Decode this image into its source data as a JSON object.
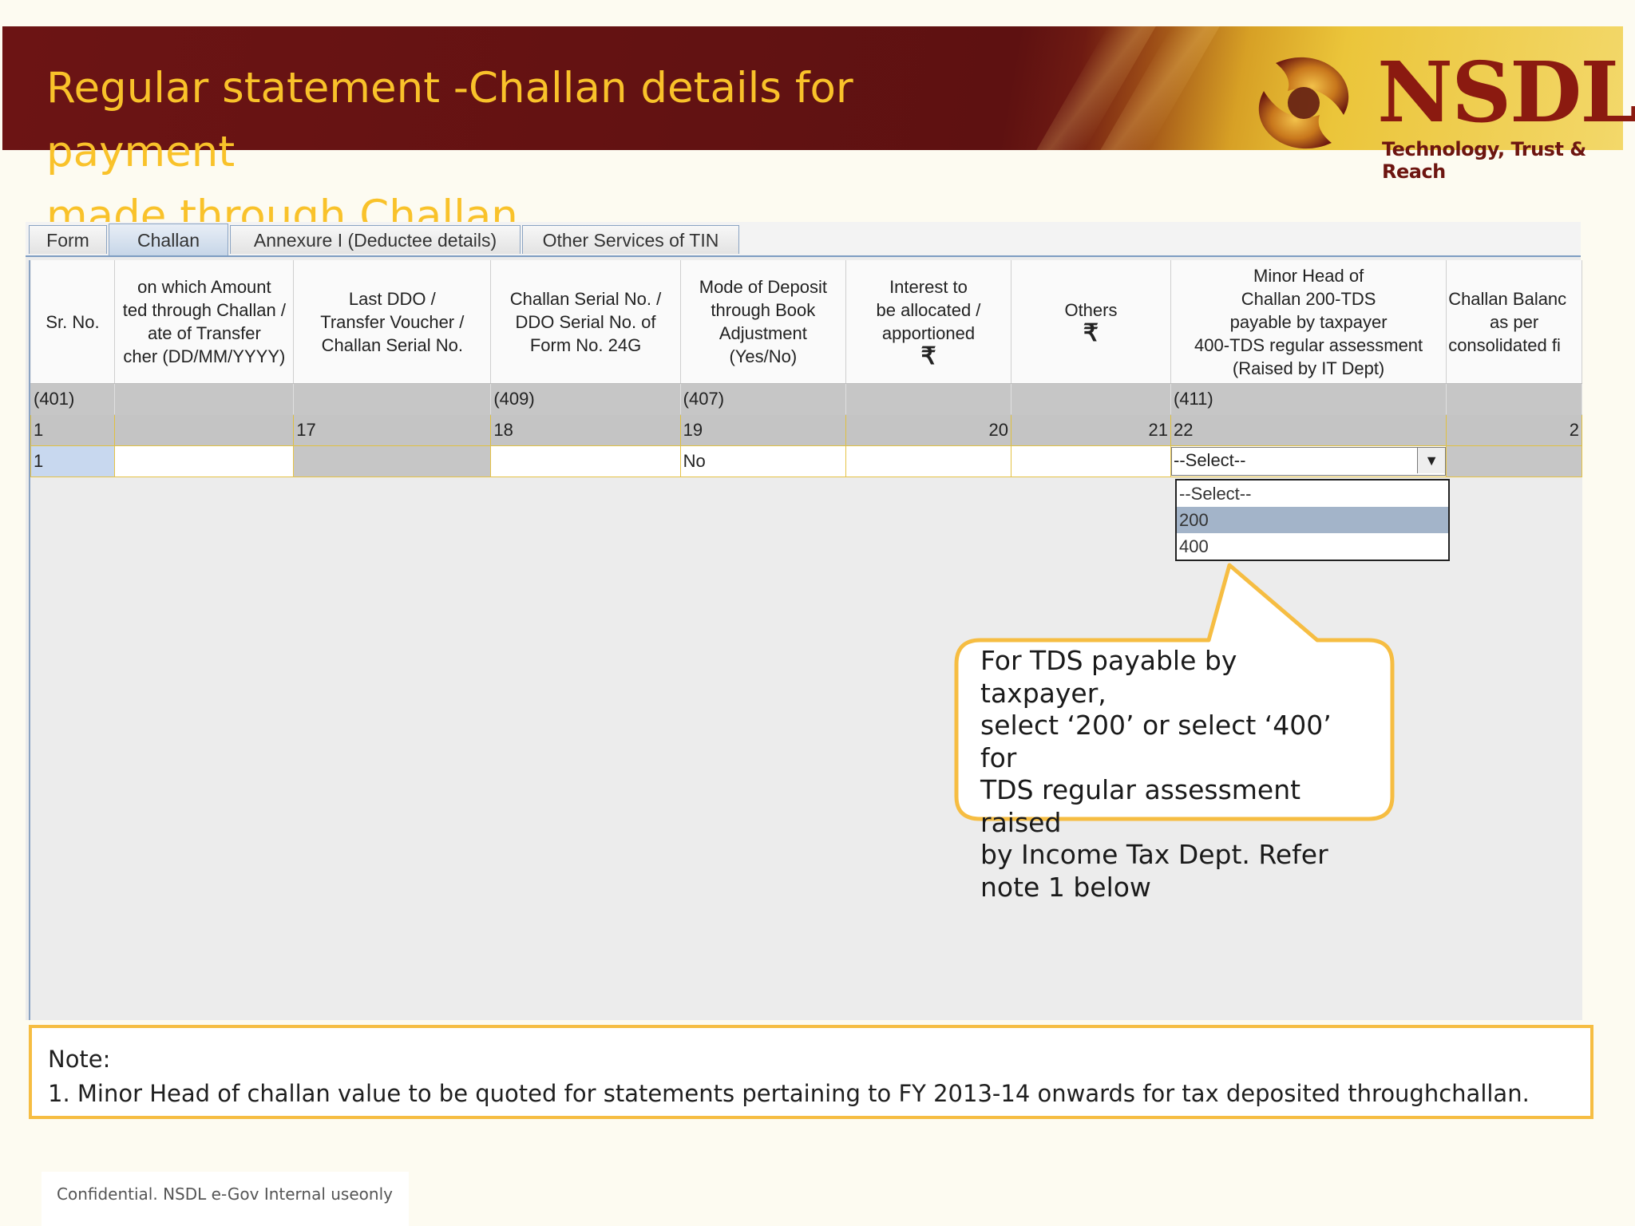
{
  "header": {
    "title_line1": "Regular statement -Challan details for payment",
    "title_line2": "made through Challan",
    "logo_name": "NSDL",
    "logo_tagline": "Technology, Trust & Reach",
    "colors": {
      "banner": "#5e1111",
      "title": "#f9c22a",
      "logo": "#8b1a10"
    }
  },
  "tabs": [
    {
      "label": "Form",
      "active": false
    },
    {
      "label": "Challan",
      "active": true
    },
    {
      "label": "Annexure I (Deductee details)",
      "active": false
    },
    {
      "label": "Other Services of TIN",
      "active": false
    }
  ],
  "table": {
    "headers": [
      {
        "lines": [
          "Sr. No."
        ]
      },
      {
        "lines": [
          "on which Amount",
          "ted through Challan /",
          "ate of Transfer",
          "cher (DD/MM/YYYY)"
        ]
      },
      {
        "lines": [
          "Last DDO /",
          "Transfer Voucher /",
          "Challan Serial No."
        ]
      },
      {
        "lines": [
          "Challan Serial No. /",
          "DDO Serial No. of",
          "Form No. 24G"
        ]
      },
      {
        "lines": [
          "Mode of Deposit",
          "through Book",
          "Adjustment",
          "(Yes/No)"
        ]
      },
      {
        "lines": [
          "Interest to",
          "be allocated /",
          "apportioned"
        ],
        "symbol": "₹"
      },
      {
        "lines": [
          "Others"
        ],
        "symbol": "₹"
      },
      {
        "lines": [
          "Minor Head of",
          "Challan 200-TDS",
          "payable by taxpayer",
          "400-TDS regular assessment",
          "(Raised by IT Dept)"
        ]
      },
      {
        "lines": [
          "Challan Balanc",
          "as per",
          "consolidated fi"
        ]
      }
    ],
    "code_row": [
      "(401)",
      "",
      "",
      "(409)",
      "(407)",
      "",
      "",
      "(411)",
      ""
    ],
    "number_row": [
      "1",
      "",
      "17",
      "18",
      "19",
      "20",
      "21",
      "22",
      "2"
    ],
    "entry_row": [
      "1",
      "",
      "",
      "",
      "No",
      "",
      "",
      "",
      ""
    ]
  },
  "minor_head_select": {
    "value": "--Select--",
    "options": [
      "--Select--",
      "200",
      "400"
    ],
    "highlighted": "200"
  },
  "callout": {
    "lines": [
      "For TDS payable by taxpayer,",
      "select ‘200’ or select ‘400’ for",
      "TDS regular assessment raised",
      "by Income Tax Dept. Refer",
      "note 1 below"
    ],
    "border_color": "#f6bd42"
  },
  "note": {
    "heading": "Note:",
    "text": "1. Minor Head of challan value to be quoted for statements pertaining to FY 2013-14 onwards for tax deposited throughchallan."
  },
  "footer": "Confidential. NSDL e-Gov Internal useonly"
}
